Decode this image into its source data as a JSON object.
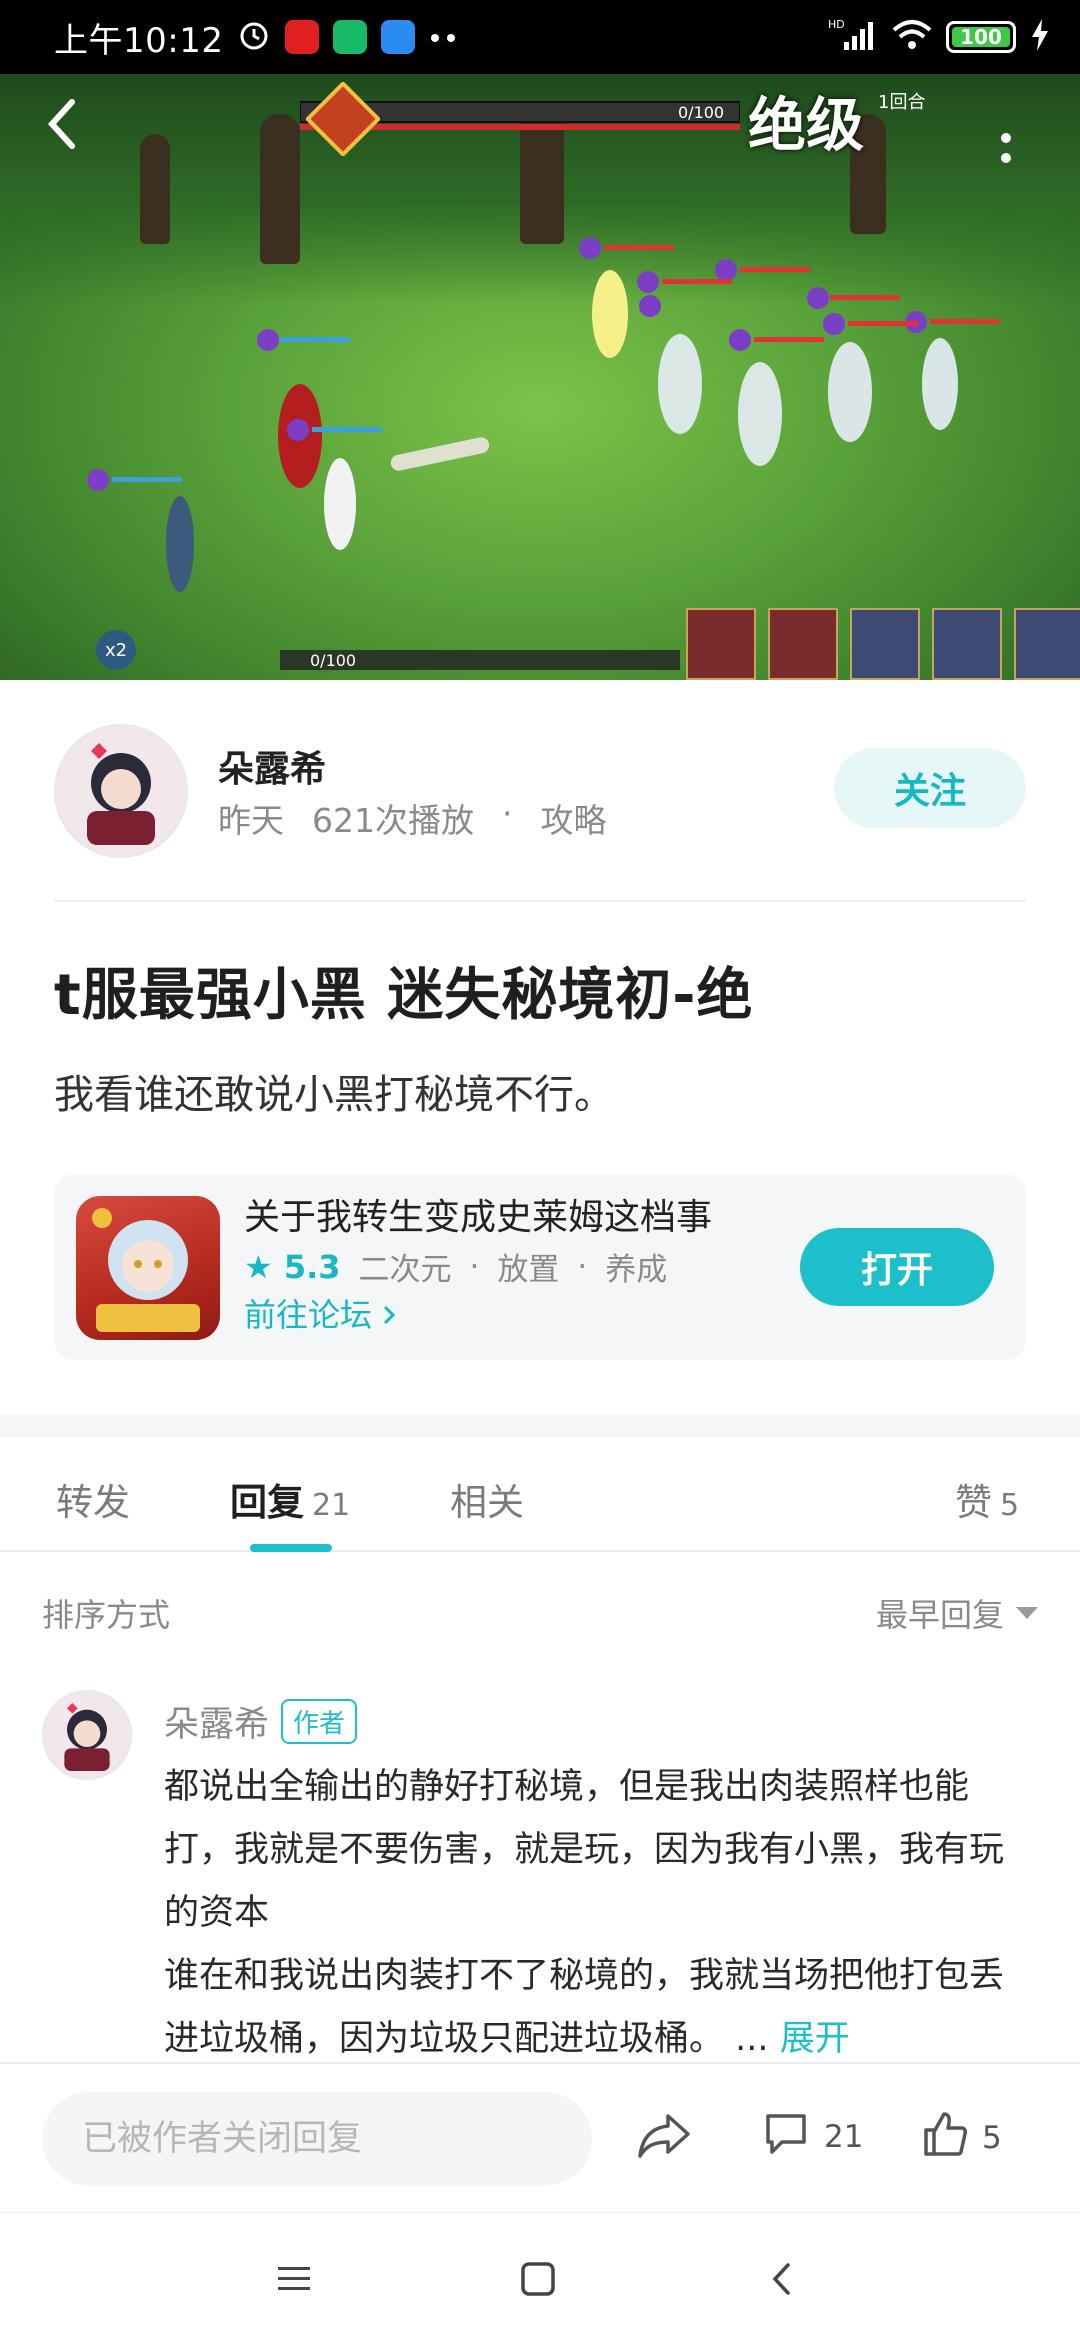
{
  "status_bar": {
    "time": "上午10:12",
    "battery": "100",
    "battery_level": 1.0,
    "network": "HD"
  },
  "video": {
    "boss_hp": "0/100",
    "difficulty_label": "绝级",
    "round_label": "1回合",
    "bottom_hp": "0/100",
    "speed": "x2"
  },
  "author": {
    "name": "朵露希",
    "date": "昨天",
    "plays": "621次播放",
    "separator": "·",
    "category": "攻略",
    "follow_label": "关注"
  },
  "post": {
    "title": "t服最强小黑 迷失秘境初-绝",
    "body": "我看谁还敢说小黑打秘境不行。"
  },
  "app_card": {
    "name": "关于我转生变成史莱姆这档事",
    "rating": "5.3",
    "tags": [
      "二次元",
      "放置",
      "养成"
    ],
    "forum_link": "前往论坛",
    "open_label": "打开"
  },
  "tabs": [
    {
      "label": "转发",
      "count": ""
    },
    {
      "label": "回复",
      "count": "21"
    },
    {
      "label": "相关",
      "count": ""
    },
    {
      "label": "赞",
      "count": "5"
    }
  ],
  "sort": {
    "label": "排序方式",
    "value": "最早回复"
  },
  "comment": {
    "name": "朵露希",
    "badge": "作者",
    "text_line1": "都说出全输出的静好打秘境，但是我出肉装照样也能打，我就是不要伤害，就是玩，因为我有小黑，我有玩的资本",
    "text_line2": "谁在和我说出肉装打不了秘境的，我就当场把他打包丢进垃圾桶，因为垃圾只配进垃圾桶。",
    "ellipsis": "...",
    "expand": "展开"
  },
  "action_bar": {
    "input_placeholder": "已被作者关闭回复",
    "comments": "21",
    "likes": "5"
  },
  "colors": {
    "accent": "#1dbfcb",
    "accent_light": "#e6f7f8"
  }
}
